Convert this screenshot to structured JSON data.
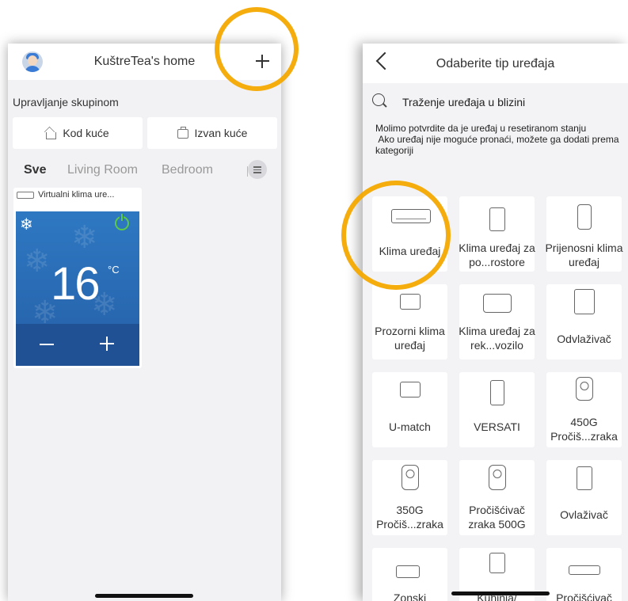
{
  "left": {
    "header_title": "KuštreTea's home",
    "group_title": "Upravljanje skupinom",
    "modes": [
      "Kod kuće",
      "Izvan kuće"
    ],
    "tabs": [
      "Sve",
      "Living Room",
      "Bedroom"
    ],
    "device": {
      "name": "Virtualni klima ure...",
      "temperature": "16",
      "unit": "°C",
      "power_on": true
    }
  },
  "right": {
    "header_title": "Odaberite tip uređaja",
    "search_label": "Traženje uređaja u blizini",
    "notice": "Molimo potvrdite da je uređaj u resetiranom stanju\n Ako uređaj nije moguće pronaći, možete ga dodati prema kategoriji",
    "device_types": [
      "Klima uređaj",
      "Klima uređaj za po...rostore",
      "Prijenosni klima uređaj",
      "Prozorni klima uređaj",
      "Klima uređaj za rek...vozilo",
      "Odvlaživač",
      "U-match",
      "VERSATI",
      "450G Pročiš...zraka",
      "350G Pročiš...zraka",
      "Pročišćivač zraka 500G",
      "Ovlaživač",
      "Zonski",
      "Kuhinja/",
      "Pročišćivač"
    ]
  },
  "colors": {
    "card_blue": "#2e78c2",
    "card_dark": "#1f5194",
    "power_green": "#5bc94a",
    "highlight_ring": "#f4b400"
  }
}
